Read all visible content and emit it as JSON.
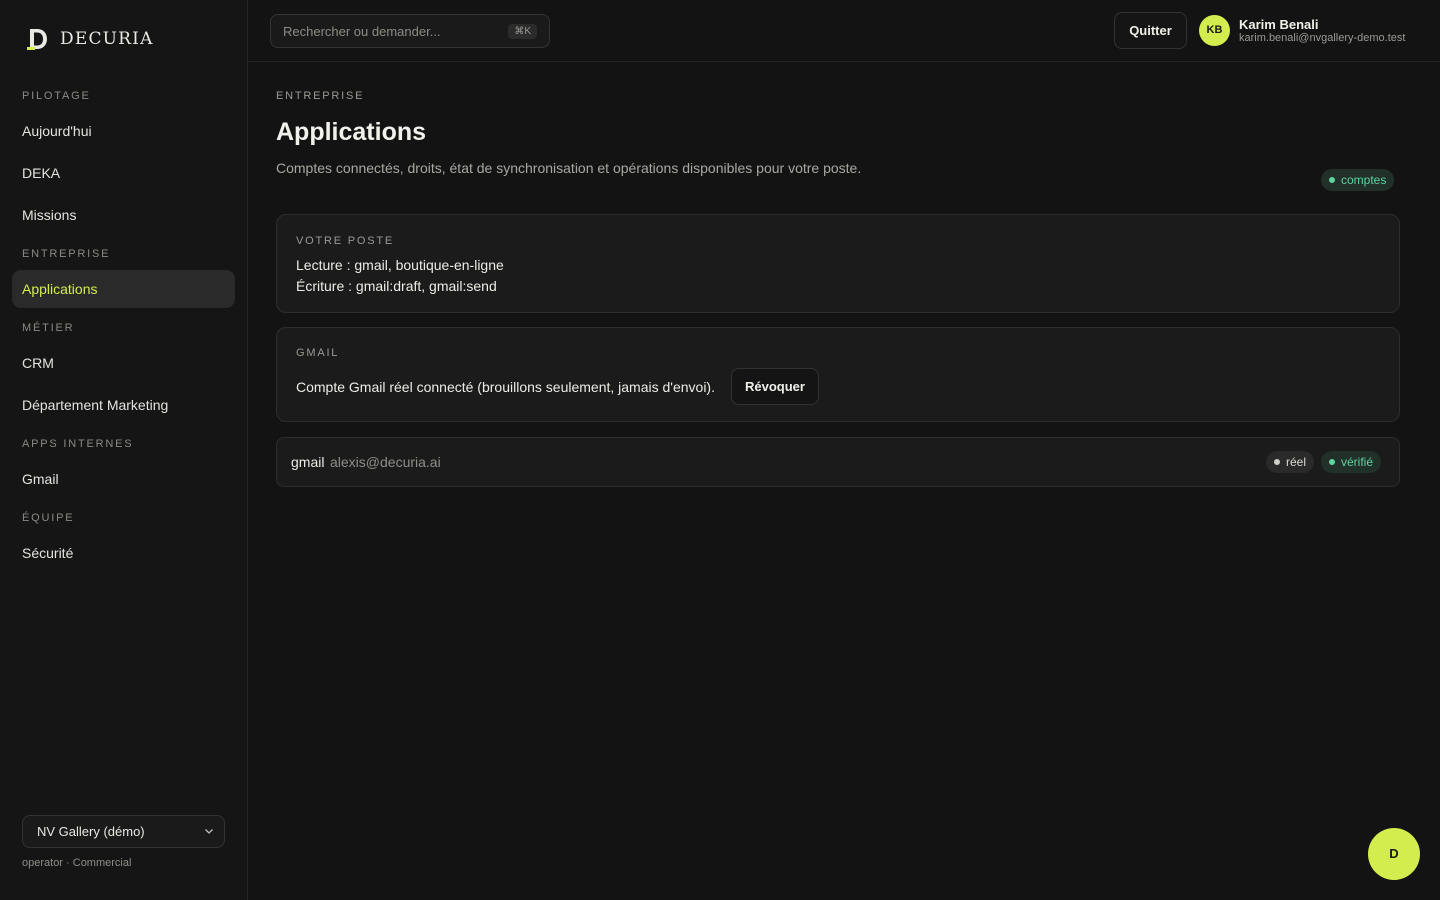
{
  "brand": {
    "name": "DECURIA",
    "logo_icon": "decuria-d-logo",
    "accent_color": "#d3ec4e"
  },
  "sidebar": {
    "sections": [
      {
        "title": "PILOTAGE",
        "items": [
          "Aujourd'hui",
          "DEKA",
          "Missions"
        ]
      },
      {
        "title": "ENTREPRISE",
        "items": [
          "Applications"
        ]
      },
      {
        "title": "MÉTIER",
        "items": [
          "CRM",
          "Département Marketing"
        ]
      },
      {
        "title": "APPS INTERNES",
        "items": [
          "Gmail"
        ]
      },
      {
        "title": "ÉQUIPE",
        "items": [
          "Sécurité"
        ]
      }
    ],
    "active_item": "Applications",
    "workspace": {
      "selected": "NV Gallery (démo)"
    },
    "role_line": "operator · Commercial"
  },
  "topbar": {
    "search_placeholder": "Rechercher ou demander...",
    "search_shortcut": "⌘K",
    "quit_label": "Quitter",
    "user": {
      "initials": "KB",
      "name": "Karim Benali",
      "email": "karim.benali@nvgallery-demo.test"
    }
  },
  "main": {
    "eyebrow": "ENTREPRISE",
    "title": "Applications",
    "description": "Comptes connectés, droits, état de synchronisation et opérations disponibles pour votre poste.",
    "status_badge": "comptes",
    "poste_card": {
      "label": "VOTRE POSTE",
      "read_line": "Lecture : gmail, boutique-en-ligne",
      "write_line": "Écriture : gmail:draft, gmail:send"
    },
    "gmail_card": {
      "label": "GMAIL",
      "text": "Compte Gmail réel connecté (brouillons seulement, jamais d'envoi).",
      "revoke_label": "Révoquer"
    },
    "account": {
      "provider": "gmail",
      "email": "alexis@decuria.ai",
      "badges": [
        "réel",
        "vérifié"
      ]
    }
  },
  "fab_label": "D"
}
